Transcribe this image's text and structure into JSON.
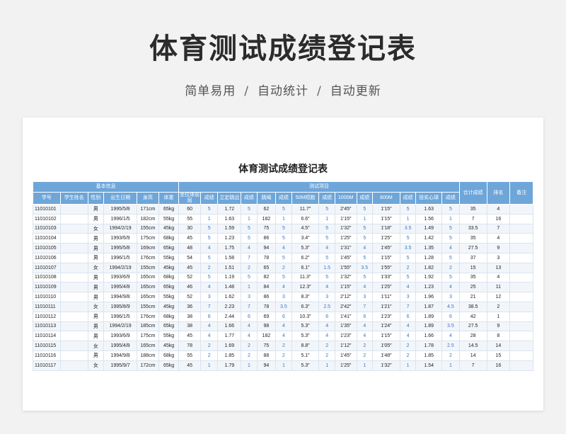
{
  "hero_title": "体育测试成绩登记表",
  "subtitle": [
    "简单易用",
    "自动统计",
    "自动更新"
  ],
  "subtitle_separator": "/",
  "sheet_title": "体育测试成绩登记表",
  "header_groups": {
    "basic": "基本信息",
    "tests": "测试项目",
    "total": "合计成绩",
    "rank": "排名",
    "note": "备注"
  },
  "columns": [
    "学号",
    "学生姓名",
    "性别",
    "出生日期",
    "身高",
    "体重",
    "坐位体前屈",
    "成绩",
    "立定跳远",
    "成绩",
    "跳绳",
    "成绩",
    "50M短跑",
    "成绩",
    "1000M",
    "成绩",
    "800M",
    "成绩",
    "投实心球",
    "成绩"
  ],
  "rows": [
    [
      "11010101",
      "",
      "男",
      "1995/5/8",
      "171cm",
      "65kg",
      "60",
      "5",
      "1.72",
      "5",
      "62",
      "5",
      "11.7″",
      "5",
      "2′45″",
      "5",
      "1′15″",
      "5",
      "1.63",
      "5",
      "35",
      "4",
      ""
    ],
    [
      "11010102",
      "",
      "男",
      "1996/1/5",
      "182cm",
      "55kg",
      "55",
      "1",
      "1.63",
      "1",
      "182",
      "1",
      "6.6″",
      "1",
      "1′15″",
      "1",
      "1′15″",
      "1",
      "1.56",
      "1",
      "7",
      "16",
      ""
    ],
    [
      "11010103",
      "",
      "女",
      "1994/2/19",
      "155cm",
      "45kg",
      "30",
      "5",
      "1.59",
      "5",
      "75",
      "5",
      "4.5″",
      "5",
      "1′32″",
      "5",
      "1′18″",
      "3.5",
      "1.49",
      "5",
      "33.5",
      "7",
      ""
    ],
    [
      "11010104",
      "",
      "男",
      "1993/6/9",
      "175cm",
      "68kg",
      "45",
      "5",
      "1.23",
      "5",
      "86",
      "5",
      "3.4″",
      "5",
      "1′25″",
      "5",
      "1′25″",
      "5",
      "1.42",
      "5",
      "35",
      "4",
      ""
    ],
    [
      "11010105",
      "",
      "男",
      "1995/5/8",
      "169cm",
      "65kg",
      "48",
      "4",
      "1.75",
      "4",
      "94",
      "4",
      "5.3″",
      "4",
      "1′31″",
      "4",
      "1′45″",
      "3.5",
      "1.35",
      "4",
      "27.5",
      "9",
      ""
    ],
    [
      "11010106",
      "",
      "男",
      "1996/1/5",
      "176cm",
      "55kg",
      "54",
      "5",
      "1.58",
      "7",
      "78",
      "5",
      "6.2″",
      "5",
      "1′45″",
      "5",
      "1′15″",
      "5",
      "1.28",
      "5",
      "37",
      "3",
      ""
    ],
    [
      "11010107",
      "",
      "女",
      "1994/2/19",
      "155cm",
      "45kg",
      "45",
      "2",
      "1.51",
      "2",
      "65",
      "2",
      "6.1″",
      "1.5",
      "1′55″",
      "3.5",
      "1′55″",
      "2",
      "1.82",
      "2",
      "15",
      "13",
      ""
    ],
    [
      "11010108",
      "",
      "男",
      "1993/6/9",
      "165cm",
      "68kg",
      "52",
      "5",
      "1.19",
      "5",
      "82",
      "5",
      "11.3″",
      "5",
      "1′32″",
      "5",
      "1′33″",
      "5",
      "1.92",
      "5",
      "35",
      "4",
      ""
    ],
    [
      "11010109",
      "",
      "男",
      "1995/4/8",
      "165cm",
      "65kg",
      "46",
      "4",
      "1.48",
      "1",
      "84",
      "4",
      "12.3″",
      "4",
      "1′15″",
      "4",
      "1′25″",
      "4",
      "1.23",
      "4",
      "25",
      "11",
      ""
    ],
    [
      "11010110",
      "",
      "男",
      "1994/9/8",
      "165cm",
      "55kg",
      "52",
      "3",
      "1.62",
      "3",
      "86",
      "3",
      "8.3″",
      "3",
      "2′12″",
      "3",
      "1′11″",
      "3",
      "1.96",
      "3",
      "21",
      "12",
      ""
    ],
    [
      "11010111",
      "",
      "女",
      "1995/8/9",
      "155cm",
      "45kg",
      "36",
      "7",
      "2.23",
      "7",
      "78",
      "3.5",
      "6.3″",
      "2.5",
      "2′42″",
      "7",
      "1′21″",
      "7",
      "1.87",
      "4.5",
      "38.5",
      "2",
      ""
    ],
    [
      "11010112",
      "",
      "男",
      "1996/1/5",
      "176cm",
      "68kg",
      "38",
      "6",
      "2.44",
      "6",
      "69",
      "6",
      "10.3″",
      "6",
      "1′41″",
      "6",
      "1′23″",
      "6",
      "1.89",
      "6",
      "42",
      "1",
      ""
    ],
    [
      "11010113",
      "",
      "男",
      "1994/2/19",
      "185cm",
      "65kg",
      "38",
      "4",
      "1.66",
      "4",
      "98",
      "4",
      "5.3″",
      "4",
      "1′35″",
      "4",
      "1′24″",
      "4",
      "1.89",
      "3.5",
      "27.5",
      "9",
      ""
    ],
    [
      "11010114",
      "",
      "男",
      "1993/6/9",
      "175cm",
      "55kg",
      "45",
      "4",
      "1.77",
      "4",
      "182",
      "4",
      "5.3″",
      "4",
      "1′23″",
      "4",
      "1′15″",
      "4",
      "1.66",
      "4",
      "28",
      "8",
      ""
    ],
    [
      "11010115",
      "",
      "女",
      "1995/4/8",
      "165cm",
      "45kg",
      "78",
      "2",
      "1.69",
      "2",
      "75",
      "2",
      "8.8″",
      "2",
      "1′12″",
      "2",
      "1′05″",
      "2",
      "1.78",
      "2.5",
      "14.5",
      "14",
      ""
    ],
    [
      "11010116",
      "",
      "男",
      "1994/9/8",
      "188cm",
      "68kg",
      "55",
      "2",
      "1.85",
      "2",
      "88",
      "2",
      "5.1″",
      "2",
      "1′45″",
      "2",
      "1′48″",
      "2",
      "1.85",
      "2",
      "14",
      "15",
      ""
    ],
    [
      "11010117",
      "",
      "女",
      "1995/9/7",
      "172cm",
      "65kg",
      "45",
      "1",
      "1.79",
      "1",
      "94",
      "1",
      "5.3″",
      "1",
      "1′25″",
      "1",
      "1′32″",
      "1",
      "1.54",
      "1",
      "7",
      "16",
      ""
    ]
  ]
}
